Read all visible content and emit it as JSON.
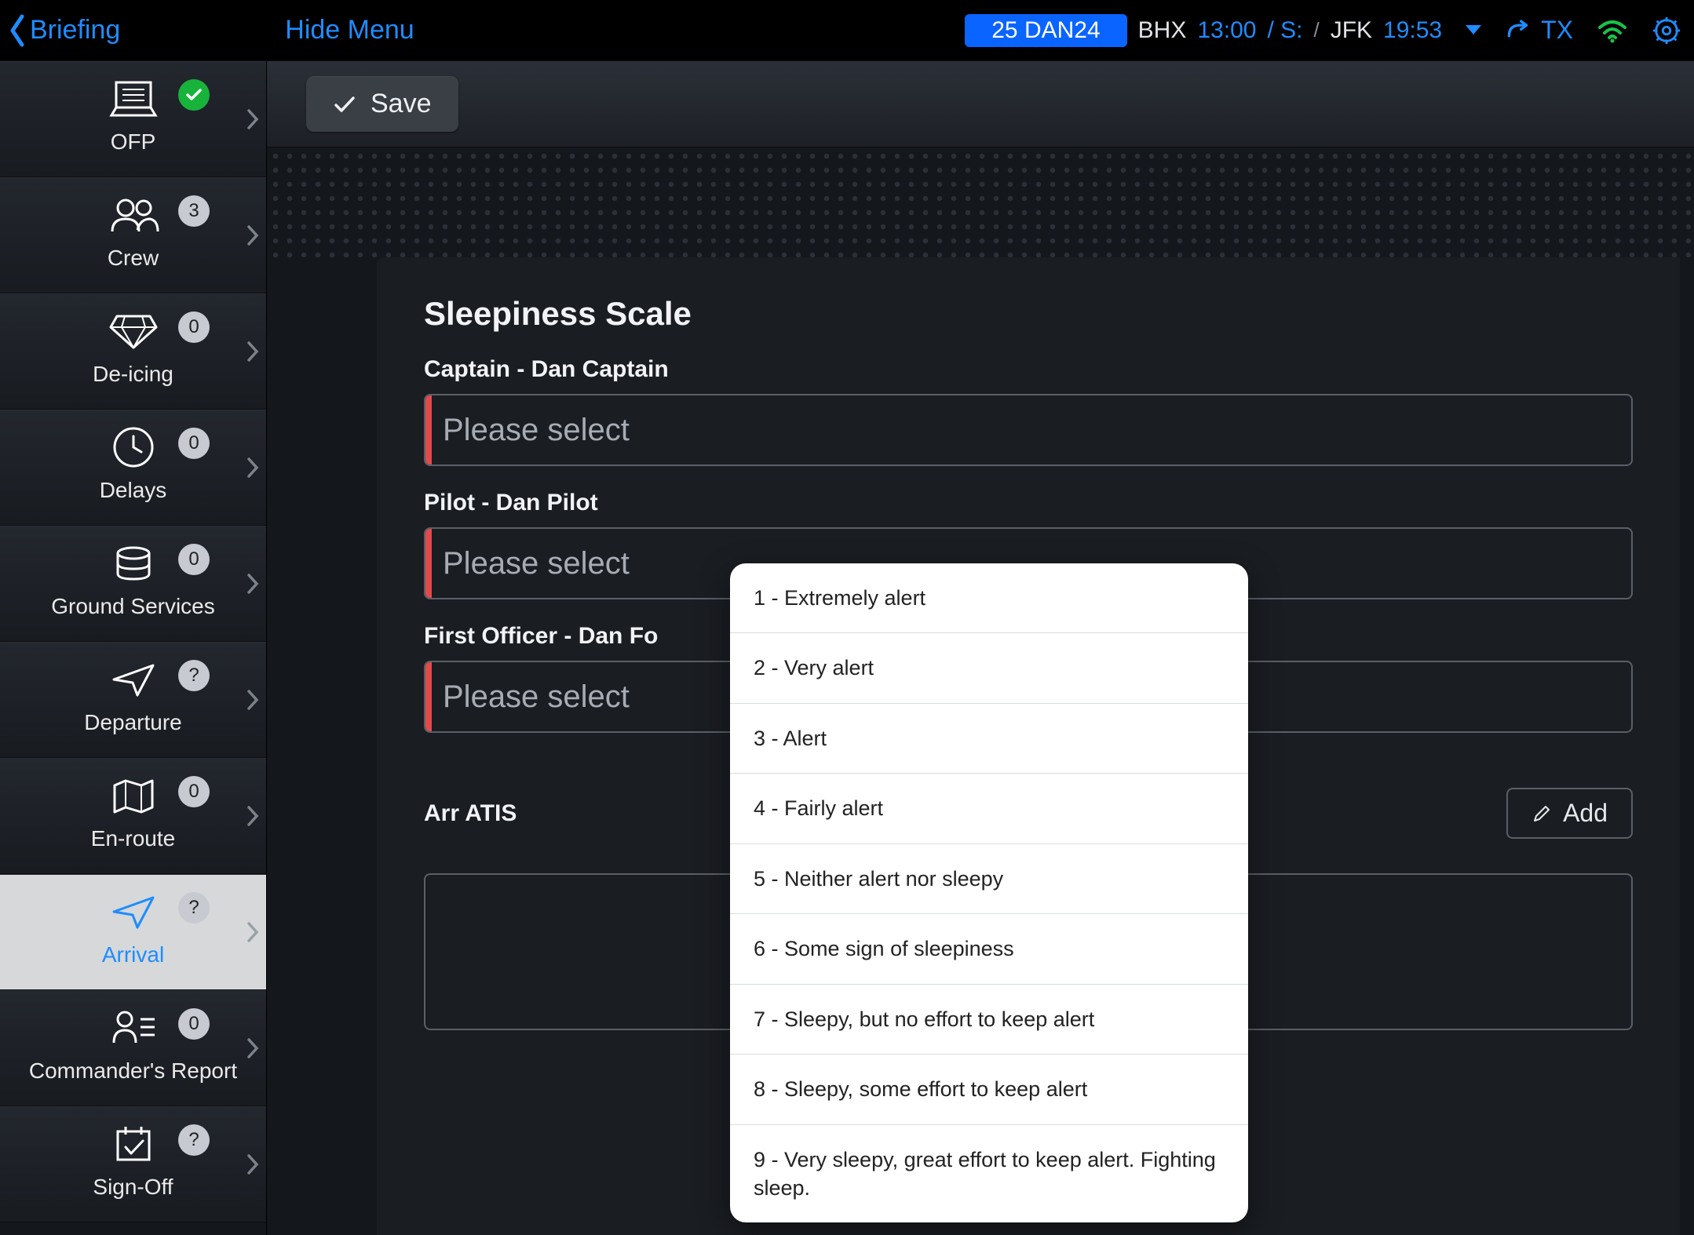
{
  "header": {
    "back_label": "Briefing",
    "hide_menu": "Hide Menu",
    "flight_id": "25 DAN24",
    "dep_code": "BHX",
    "dep_time": "13:00",
    "dep_extra": "/ S:",
    "sep": "/",
    "arr_code": "JFK",
    "arr_time": "19:53",
    "tx_label": "TX"
  },
  "sidebar": {
    "items": [
      {
        "label": "OFP",
        "badge": "",
        "badge_type": "green"
      },
      {
        "label": "Crew",
        "badge": "3",
        "badge_type": "grey"
      },
      {
        "label": "De-icing",
        "badge": "0",
        "badge_type": "grey"
      },
      {
        "label": "Delays",
        "badge": "0",
        "badge_type": "grey"
      },
      {
        "label": "Ground Services",
        "badge": "0",
        "badge_type": "grey"
      },
      {
        "label": "Departure",
        "badge": "?",
        "badge_type": "grey"
      },
      {
        "label": "En-route",
        "badge": "0",
        "badge_type": "grey"
      },
      {
        "label": "Arrival",
        "badge": "?",
        "badge_type": "grey"
      },
      {
        "label": "Commander's Report",
        "badge": "0",
        "badge_type": "grey"
      },
      {
        "label": "Sign-Off",
        "badge": "?",
        "badge_type": "grey"
      }
    ]
  },
  "toolbar": {
    "save_label": "Save"
  },
  "panel": {
    "heading": "Sleepiness Scale",
    "captain_label": "Captain - Dan Captain",
    "captain_value": "Please select",
    "pilot_label": "Pilot - Dan Pilot",
    "pilot_value": "Please select",
    "fo_label": "First Officer - Dan Fo",
    "fo_value": "Please select",
    "atis_label": "Arr ATIS",
    "add_label": "Add"
  },
  "dropdown": {
    "items": [
      "1 - Extremely alert",
      "2 - Very alert",
      "3 - Alert",
      "4 - Fairly alert",
      "5 - Neither alert nor sleepy",
      "6 - Some sign of sleepiness",
      "7 - Sleepy, but no effort to keep alert",
      "8 - Sleepy, some effort to keep alert",
      "9 - Very sleepy, great effort to keep alert. Fighting sleep."
    ]
  }
}
